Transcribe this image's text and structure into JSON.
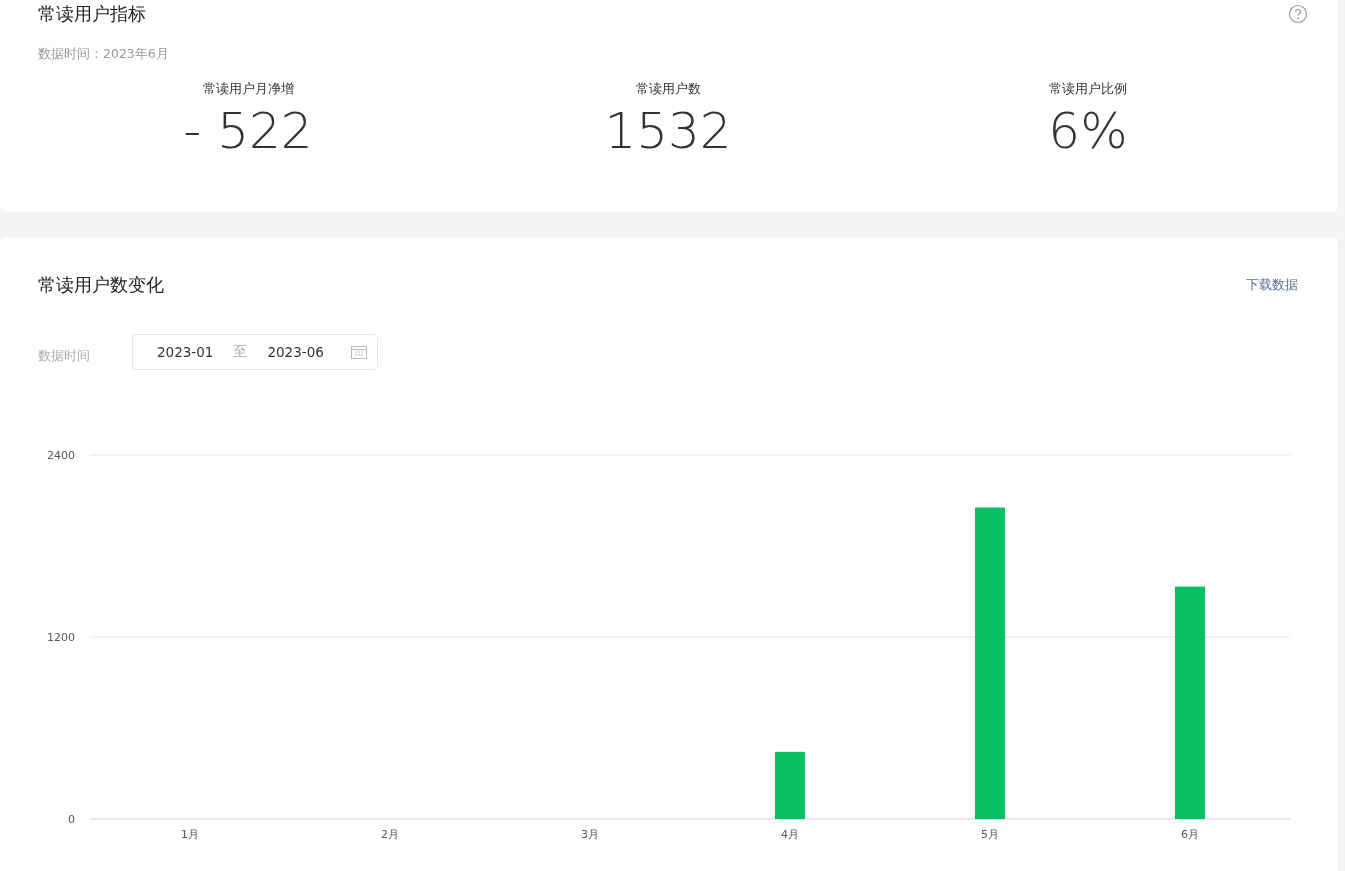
{
  "indicators": {
    "title": "常读用户指标",
    "data_time": "数据时间：2023年6月",
    "metrics": [
      {
        "label": "常读用户月净增",
        "value": "- 522"
      },
      {
        "label": "常读用户数",
        "value": "1532"
      },
      {
        "label": "常读用户比例",
        "value": "6%"
      }
    ]
  },
  "trend": {
    "title": "常读用户数变化",
    "download_link": "下载数据",
    "date_filter": {
      "label": "数据时间",
      "start": "2023-01",
      "separator": "至",
      "end": "2023-06"
    },
    "chart_data": {
      "type": "bar",
      "categories": [
        "1月",
        "2月",
        "3月",
        "4月",
        "5月",
        "6月"
      ],
      "series": [
        {
          "color": "#07c160",
          "values": [
            0,
            0,
            0,
            443,
            2054,
            1532
          ]
        }
      ],
      "ylim": [
        0,
        2400
      ],
      "yticks": [
        0,
        1200,
        2400
      ]
    }
  }
}
